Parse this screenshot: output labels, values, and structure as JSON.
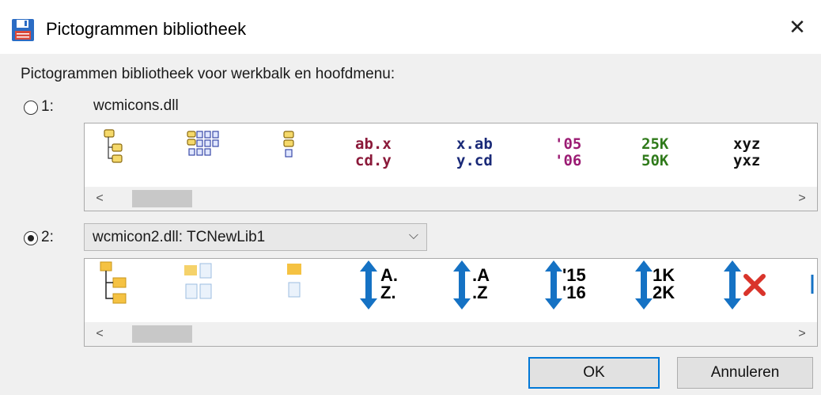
{
  "window": {
    "title": "Pictogrammen bibliotheek",
    "close_glyph": "✕",
    "icon": "floppy-disk-icon"
  },
  "prompt": "Pictogrammen bibliotheek voor werkbalk en hoofdmenu:",
  "option1": {
    "label": "1:",
    "selected": false,
    "library": "wcmicons.dll",
    "icons": [
      {
        "name": "tree-folders-icon"
      },
      {
        "name": "folder-grid-icon"
      },
      {
        "name": "folder-stack-icon"
      },
      {
        "name": "sort-name-ext-icon",
        "line1": "ab.x",
        "line2": "cd.y",
        "color": "#8b1a3a"
      },
      {
        "name": "sort-ext-name-icon",
        "line1": "x.ab",
        "line2": "y.cd",
        "color": "#1a2a78"
      },
      {
        "name": "sort-date-icon",
        "line1": "'05",
        "line2": "'06",
        "color": "#9b1b73"
      },
      {
        "name": "sort-size-icon",
        "line1": "25K",
        "line2": "50K",
        "color": "#2f7a1a"
      },
      {
        "name": "sort-unsorted-icon",
        "line1": "xyz",
        "line2": "yxz",
        "color": "#111111"
      }
    ]
  },
  "option2": {
    "label": "2:",
    "selected": true,
    "library": "wcmicon2.dll: TCNewLib1",
    "icons": [
      {
        "name": "tree-folders-icon"
      },
      {
        "name": "folder-files-icon"
      },
      {
        "name": "folder-file-icon"
      },
      {
        "name": "sort-name-ext-icon",
        "line1": "A.",
        "line2": "Z."
      },
      {
        "name": "sort-ext-name-icon",
        "line1": ".A",
        "line2": ".Z"
      },
      {
        "name": "sort-date-icon",
        "line1": "'15",
        "line2": "'16"
      },
      {
        "name": "sort-size-icon",
        "line1": "1K",
        "line2": "2K"
      },
      {
        "name": "unsort-icon"
      }
    ]
  },
  "scroll": {
    "left": "<",
    "right": ">"
  },
  "buttons": {
    "ok": "OK",
    "cancel": "Annuleren"
  },
  "colors": {
    "accent": "#0078d7",
    "arrow_blue": "#1572c4",
    "folder": "#f5c242",
    "red_x": "#d9342b"
  }
}
